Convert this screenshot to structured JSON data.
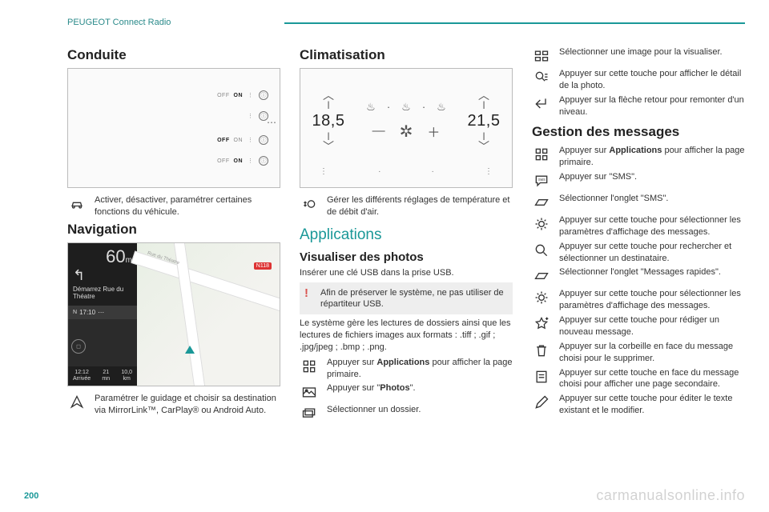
{
  "header": {
    "section": "PEUGEOT Connect Radio"
  },
  "page_number": "200",
  "watermark": "carmanualsonline.info",
  "col1": {
    "conduite": {
      "title": "Conduite",
      "rows": [
        {
          "off": "OFF",
          "on": "ON"
        },
        {
          "off": "",
          "on": ""
        },
        {
          "off": "OFF",
          "on": "ON"
        },
        {
          "off": "OFF",
          "on": "ON"
        }
      ],
      "desc": "Activer, désactiver, paramétrer certaines fonctions du véhicule."
    },
    "navigation": {
      "title": "Navigation",
      "panel": {
        "distance": "60",
        "distance_unit": "m",
        "street": "Démarrez Rue du Théatre",
        "time": "17:10",
        "eta_label": "Arrivée",
        "eta_time": "12:12",
        "eta_min": "21",
        "eta_min_unit": "mn",
        "eta_km": "10,0",
        "eta_km_unit": "km",
        "road_shield": "N118",
        "map_street": "Rue du Théatre"
      },
      "desc": "Paramétrer le guidage et choisir sa destination via MirrorLink™, CarPlay® ou Android Auto."
    }
  },
  "col2": {
    "climatisation": {
      "title": "Climatisation",
      "left_temp": "18,5",
      "right_temp": "21,5",
      "desc": "Gérer les différents réglages de température et de débit d'air."
    },
    "applications_title": "Applications",
    "photos": {
      "title": "Visualiser des photos",
      "intro": "Insérer une clé USB dans la prise USB.",
      "warning": "Afin de préserver le système, ne pas utiliser de répartiteur USB.",
      "formats": "Le système gère les lectures de dossiers ainsi que les lectures de fichiers images aux formats : .tiff ; .gif ; .jpg/jpeg ; .bmp ; .png.",
      "step_apps_a": "Appuyer sur ",
      "step_apps_b": "Applications",
      "step_apps_c": " pour afficher la page primaire.",
      "step_photos_a": "Appuyer sur \"",
      "step_photos_b": "Photos",
      "step_photos_c": "\".",
      "step_folder": "Sélectionner un dossier."
    }
  },
  "col3": {
    "photos_more": {
      "select_image": "Sélectionner une image pour la visualiser.",
      "detail": "Appuyer sur cette touche pour afficher le détail de la photo.",
      "back": "Appuyer sur la flèche retour pour remonter d'un niveau."
    },
    "messages": {
      "title": "Gestion des messages",
      "step_apps_a": "Appuyer sur ",
      "step_apps_b": "Applications",
      "step_apps_c": " pour afficher la page primaire.",
      "step_sms": "Appuyer sur \"SMS\".",
      "step_tab_sms": "Sélectionner l'onglet \"SMS\".",
      "step_params1": "Appuyer sur cette touche pour sélectionner les paramètres d'affichage des messages.",
      "step_search": "Appuyer sur cette touche pour rechercher et sélectionner un destinataire.",
      "step_tab_quick": "Sélectionner l'onglet \"Messages rapides\".",
      "step_params2": "Appuyer sur cette touche pour sélectionner les paramètres d'affichage des messages.",
      "step_new": "Appuyer sur cette touche pour rédiger un nouveau message.",
      "step_trash": "Appuyer sur la corbeille en face du message choisi pour le supprimer.",
      "step_secondary": "Appuyer sur cette touche en face du message choisi pour afficher une page secondaire.",
      "step_edit": "Appuyer sur cette touche pour éditer le texte existant et le modifier."
    }
  }
}
